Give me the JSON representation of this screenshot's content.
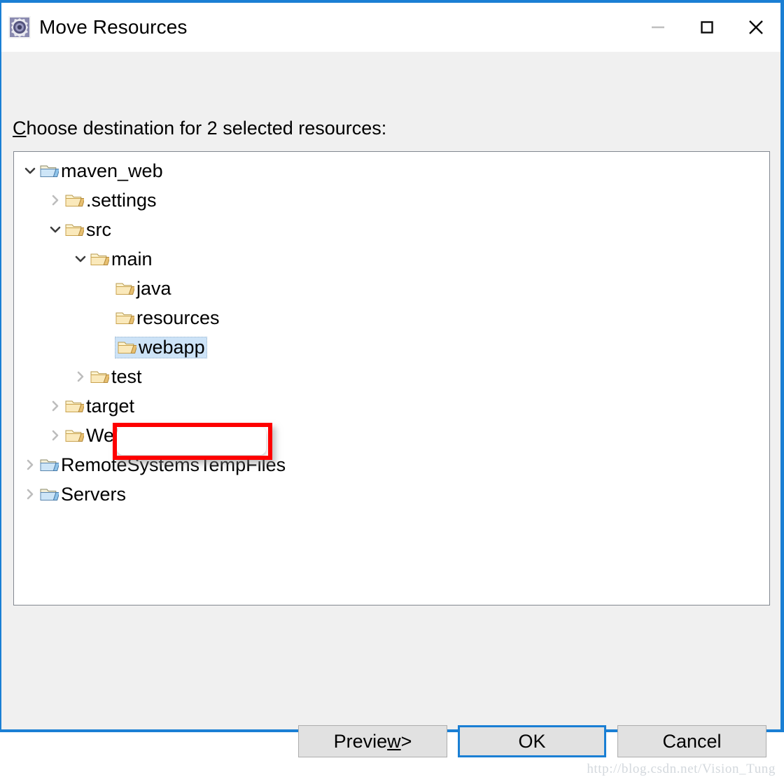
{
  "window": {
    "title": "Move Resources",
    "icon": "gear-icon",
    "accent_color": "#1a7fd4",
    "body_background": "#f0f0f0",
    "controls": [
      {
        "name": "minimize",
        "glyph": "—",
        "enabled": false
      },
      {
        "name": "maximize",
        "glyph": "□",
        "enabled": true
      },
      {
        "name": "close",
        "glyph": "✕",
        "enabled": true
      }
    ]
  },
  "prompt": {
    "mnemonic": "C",
    "rest": "hoose destination for 2 selected resources:",
    "selected_count": 2
  },
  "tree": {
    "items": [
      {
        "label": "maven_web",
        "depth": 0,
        "twisty": "expanded",
        "icon": "project-folder-icon",
        "selected": false
      },
      {
        "label": ".settings",
        "depth": 1,
        "twisty": "collapsed",
        "icon": "folder-icon",
        "selected": false
      },
      {
        "label": "src",
        "depth": 1,
        "twisty": "expanded",
        "icon": "folder-icon",
        "selected": false
      },
      {
        "label": "main",
        "depth": 2,
        "twisty": "expanded",
        "icon": "folder-icon",
        "selected": false
      },
      {
        "label": "java",
        "depth": 3,
        "twisty": "none",
        "icon": "folder-icon",
        "selected": false
      },
      {
        "label": "resources",
        "depth": 3,
        "twisty": "none",
        "icon": "folder-icon",
        "selected": false
      },
      {
        "label": "webapp",
        "depth": 3,
        "twisty": "none",
        "icon": "folder-icon",
        "selected": true
      },
      {
        "label": "test",
        "depth": 2,
        "twisty": "collapsed",
        "icon": "folder-icon",
        "selected": false
      },
      {
        "label": "target",
        "depth": 1,
        "twisty": "collapsed",
        "icon": "folder-icon",
        "selected": false
      },
      {
        "label": "WebContent",
        "depth": 1,
        "twisty": "collapsed",
        "icon": "folder-icon",
        "selected": false
      },
      {
        "label": "RemoteSystemsTempFiles",
        "depth": 0,
        "twisty": "collapsed",
        "icon": "project-folder-icon",
        "selected": false
      },
      {
        "label": "Servers",
        "depth": 0,
        "twisty": "collapsed",
        "icon": "project-folder-icon",
        "selected": false
      }
    ],
    "selection_color": "#cde3f7",
    "annotation_color": "#fe0000"
  },
  "buttons": {
    "preview": {
      "pre": "Previe",
      "mnemonic": "w",
      "post": " >"
    },
    "ok": {
      "label": "OK",
      "is_default": true
    },
    "cancel": {
      "label": "Cancel"
    }
  },
  "watermark": {
    "text": "http://blog.csdn.net/Vision_Tung"
  }
}
